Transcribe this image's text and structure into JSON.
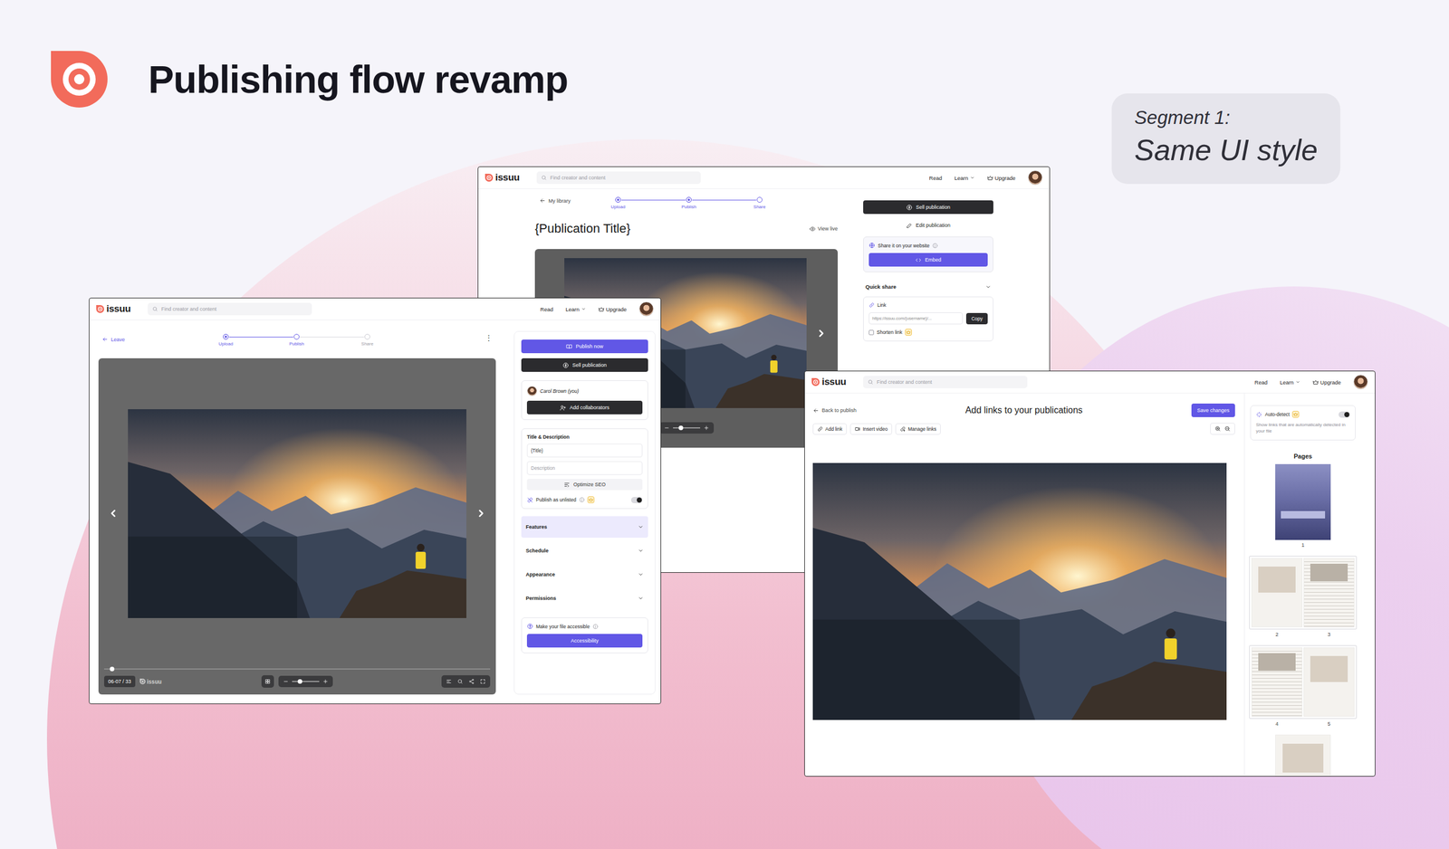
{
  "header": {
    "title": "Publishing flow revamp",
    "segment_label": "Segment 1:",
    "segment_name": "Same UI style"
  },
  "nav": {
    "brand": "issuu",
    "search_placeholder": "Find creator and content",
    "links": [
      {
        "label": "Read",
        "dropdown": false
      },
      {
        "label": "Learn",
        "dropdown": true
      }
    ],
    "upgrade": "Upgrade"
  },
  "share_window": {
    "back": "My library",
    "steps": [
      {
        "label": "Upload",
        "state": "done"
      },
      {
        "label": "Publish",
        "state": "done"
      },
      {
        "label": "Share",
        "state": "current"
      }
    ],
    "title": "{Publication Title}",
    "view_live": "View live",
    "tooltip": "Search",
    "zoom_level": 0.3,
    "sell": "Sell publication",
    "edit": "Edit publication",
    "website": {
      "label": "Share it on your website",
      "button": "Embed"
    },
    "quick_share": {
      "label": "Quick share",
      "expanded": true,
      "link_label": "Link",
      "url": "https://issuu.com/{username}/...",
      "copy": "Copy",
      "shorten": {
        "label": "Shorten link",
        "checked": false
      }
    }
  },
  "publish_window": {
    "back": "Leave",
    "menu": "⋮",
    "steps": [
      {
        "label": "Upload",
        "state": "done"
      },
      {
        "label": "Publish",
        "state": "current"
      },
      {
        "label": "Share",
        "state": "todo"
      }
    ],
    "pages": "06-07 / 33",
    "brand": "issuu",
    "progress": 0.02,
    "zoom_level": 0.3,
    "publish_now": "Publish now",
    "sell": "Sell publication",
    "collaborator": {
      "name": "Carol Brown (you)",
      "button": "Add collaborators"
    },
    "details": {
      "label": "Title & Description",
      "title_value": "{Title}",
      "description_placeholder": "Description",
      "seo": "Optimize SEO"
    },
    "unlisted": {
      "label": "Publish as unlisted",
      "on": true
    },
    "sections": [
      {
        "label": "Features",
        "selected": true,
        "expanded": false
      },
      {
        "label": "Schedule",
        "selected": false,
        "expanded": false
      },
      {
        "label": "Appearance",
        "selected": false,
        "expanded": false
      },
      {
        "label": "Permissions",
        "selected": false,
        "expanded": false
      }
    ],
    "accessibility": {
      "label": "Make your file accessible",
      "button": "Accessibility"
    }
  },
  "links_window": {
    "back": "Back to publish",
    "title": "Add links to your publications",
    "save": "Save changes",
    "tools": [
      {
        "label": "Add link",
        "kind": "link"
      },
      {
        "label": "Insert video",
        "kind": "video"
      },
      {
        "label": "Manage links",
        "kind": "manage"
      }
    ],
    "auto_detect": {
      "label": "Auto-detect",
      "on": true,
      "hint": "Show links that are automatically detected in your file"
    },
    "pages_title": "Pages",
    "thumbnails": [
      {
        "kind": "single",
        "pages": [
          "1"
        ]
      },
      {
        "kind": "spread",
        "pages": [
          "2",
          "3"
        ]
      },
      {
        "kind": "spread",
        "pages": [
          "4",
          "5"
        ]
      },
      {
        "kind": "single",
        "pages": []
      }
    ]
  }
}
